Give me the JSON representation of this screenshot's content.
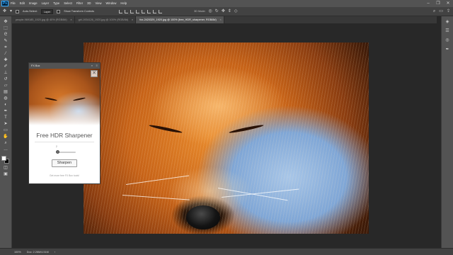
{
  "menu": {
    "logo": "Ps",
    "items": [
      {
        "label": "File"
      },
      {
        "label": "Edit"
      },
      {
        "label": "Image"
      },
      {
        "label": "Layer"
      },
      {
        "label": "Type"
      },
      {
        "label": "Select"
      },
      {
        "label": "Filter"
      },
      {
        "label": "3D"
      },
      {
        "label": "View"
      },
      {
        "label": "Window"
      },
      {
        "label": "Help"
      }
    ]
  },
  "options": {
    "auto_select_label": "Auto-Select:",
    "auto_select_value": "Layer",
    "transform_label": "Show Transform Controls",
    "mode_3d_label": "3D Mode:"
  },
  "tabs": [
    {
      "label": "people-969185_1920.jpg @ 40% (RGB/8#)"
    },
    {
      "label": "girl-1934126_1920.jpg @ 100% (RGB/8#)"
    },
    {
      "label": "fox-2420329_1920.jpg @ 100% (free_HDR_sharpener, RGB/8#)"
    }
  ],
  "panel": {
    "title": "FX Box",
    "heading": "Free HDR Sharpener",
    "slider_value_text": "2",
    "slider_level": 0.1,
    "button_label": "Sharpen",
    "link_text": "Get more free FX Box tools!"
  },
  "status": {
    "zoom": "100%",
    "doc_info": "Doc: 2.26M/4.51M"
  },
  "colors": {
    "menubar": "#535353",
    "optbar": "#424242",
    "canvas": "#282828",
    "active_tab": "#535353",
    "panel_bg": "#ffffff"
  }
}
